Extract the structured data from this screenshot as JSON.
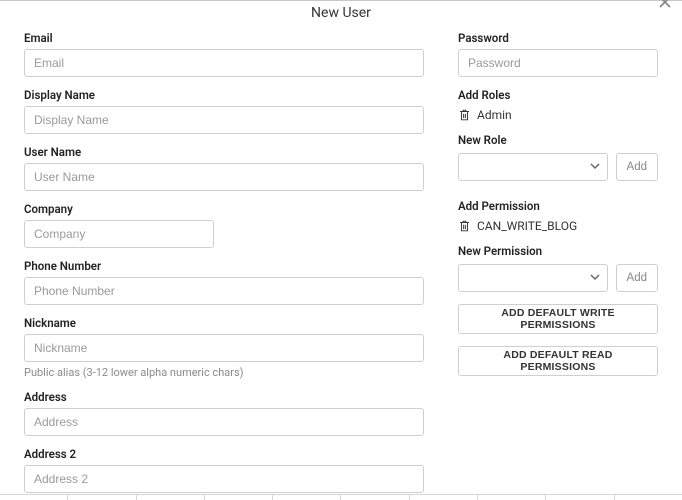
{
  "title": "New User",
  "left": {
    "email": {
      "label": "Email",
      "placeholder": "Email"
    },
    "displayName": {
      "label": "Display Name",
      "placeholder": "Display Name"
    },
    "userName": {
      "label": "User Name",
      "placeholder": "User Name"
    },
    "company": {
      "label": "Company",
      "placeholder": "Company"
    },
    "phone": {
      "label": "Phone Number",
      "placeholder": "Phone Number"
    },
    "nickname": {
      "label": "Nickname",
      "placeholder": "Nickname",
      "hint": "Public alias (3-12 lower alpha numeric chars)"
    },
    "address": {
      "label": "Address",
      "placeholder": "Address"
    },
    "address2": {
      "label": "Address 2",
      "placeholder": "Address 2"
    }
  },
  "right": {
    "password": {
      "label": "Password",
      "placeholder": "Password"
    },
    "roles": {
      "heading": "Add Roles",
      "items": [
        "Admin"
      ]
    },
    "newRole": {
      "label": "New Role",
      "addLabel": "Add"
    },
    "permissions": {
      "heading": "Add Permission",
      "items": [
        "CAN_WRITE_BLOG"
      ]
    },
    "newPermission": {
      "label": "New Permission",
      "addLabel": "Add"
    },
    "defaultWriteBtn": "ADD DEFAULT WRITE PERMISSIONS",
    "defaultReadBtn": "ADD DEFAULT READ PERMISSIONS"
  }
}
